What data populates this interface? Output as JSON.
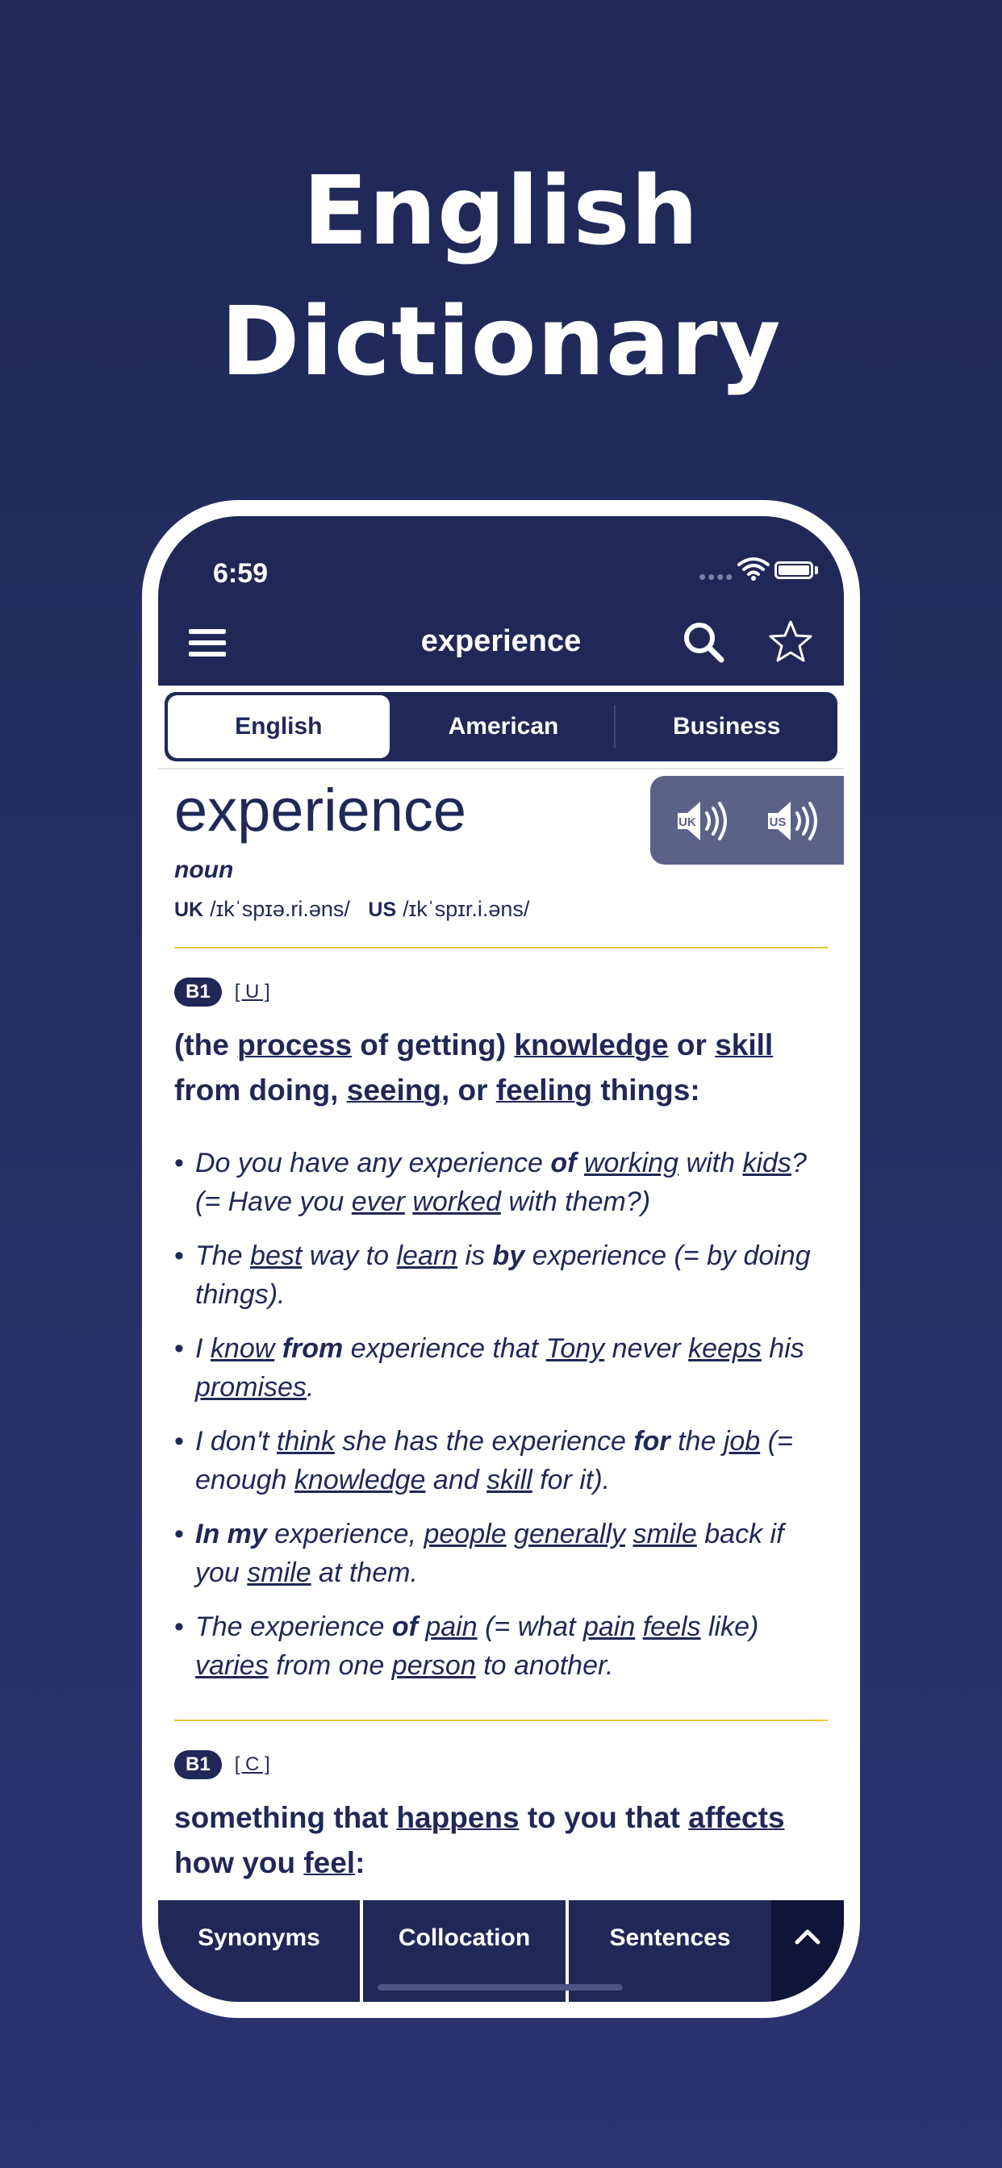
{
  "hero": {
    "line1": "English",
    "line2": "Dictionary"
  },
  "status": {
    "time": "6:59",
    "signal": "••••"
  },
  "nav": {
    "title": "experience"
  },
  "tabs": [
    {
      "label": "English",
      "active": true
    },
    {
      "label": "American",
      "active": false
    },
    {
      "label": "Business",
      "active": false
    }
  ],
  "entry": {
    "headword": "experience",
    "pos": "noun",
    "uk_label": "UK",
    "uk_ipa": "/ɪkˈspɪə.ri.əns/",
    "us_label": "US",
    "us_ipa": "/ɪkˈspɪr.i.əns/",
    "audio": [
      {
        "icon": "speaker-uk-icon",
        "label": "UK"
      },
      {
        "icon": "speaker-us-icon",
        "label": "US"
      }
    ]
  },
  "senses": [
    {
      "level": "B1",
      "grammar": "[ U ]",
      "definition_html": "(the <u>process</u> of getting) <u>knowledge</u> or <u>skill</u> from doing, <u>seeing</u>, or <u>feeling</u> things:",
      "examples": [
        "Do you have any experience <b>of</b> <u>working</u> with <u>kids</u>? (= Have you <u>ever</u> <u>worked</u> with them?)",
        "The <u>best</u> way to <u>learn</u> is <b>by</b> experience (= by doing things).",
        "I <u>know</u> <b>from</b> experience that <u>Tony</u> never <u>keeps</u> his <u>promises</u>.",
        "I don't <u>think</u> she has the experience <b>for</b> the <u>job</u> (= enough <u>knowledge</u> and <u>skill</u> for it).",
        "<b>In my</b> experience, <u>people</u> <u>generally</u> <u>smile</u> back if you <u>smile</u> at them.",
        "The experience <b>of</b> <u>pain</u> (= what <u>pain</u> <u>feels</u> like) <u>varies</u> from one <u>person</u> to another."
      ]
    },
    {
      "level": "B1",
      "grammar": "[ C ]",
      "definition_html": "something that <u>happens</u> to you that <u>affects</u> how you <u>feel</u>:"
    }
  ],
  "bottom": {
    "synonyms": "Synonyms",
    "collocation": "Collocation",
    "sentences": "Sentences",
    "up_icon": "chevron-up-icon"
  },
  "colors": {
    "navy": "#1f2856",
    "gold": "#f0c437",
    "audio_bg": "#5a6288"
  }
}
